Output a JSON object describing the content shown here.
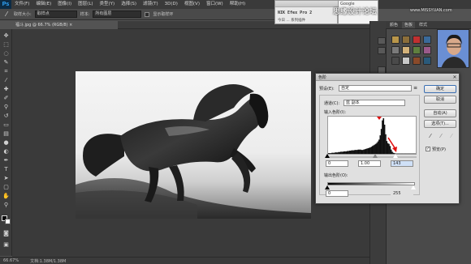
{
  "app": {
    "logo": "Ps"
  },
  "menu": [
    "文件(F)",
    "编辑(E)",
    "图像(I)",
    "图层(L)",
    "类型(Y)",
    "选择(S)",
    "滤镜(T)",
    "3D(D)",
    "视图(V)",
    "窗口(W)",
    "帮助(H)"
  ],
  "options": {
    "sample_size_label": "取样大小:",
    "sample_size_value": "取样点",
    "sample_label": "样本:",
    "sample_value": "所有图层",
    "show_ring_label": "显示取样环"
  },
  "document": {
    "tab_label": "福斗.jpg @ 66.7% (RGB/8) ×"
  },
  "status": {
    "zoom": "66.67%",
    "doc_size": "文档:1.38M/1.38M"
  },
  "overlay": {
    "nik_title": "NIK Efex Pro 2",
    "nik_sub": "今日 ... 系列插件",
    "google": "Google"
  },
  "watermark": {
    "main": "思缘设计论坛",
    "url": "www.MISSYUAN.com"
  },
  "panel_tabs": [
    "颜色",
    "色板",
    "样式"
  ],
  "swatch_colors": [
    "#b9964a",
    "#8c6e3a",
    "#c03030",
    "#3a6a9a",
    "#7a7a7a",
    "#d3b27a",
    "#5f7f3f",
    "#9a5a8a",
    "#4a4a4a",
    "#c9c9c9",
    "#8a4a2a",
    "#2a5a7a"
  ],
  "levels": {
    "title": "色阶",
    "preset_label": "预设(E):",
    "preset_value": "自定",
    "channel_label": "通道(C):",
    "channel_value": "蓝 副本",
    "input_label": "输入色阶(I):",
    "input_black": "0",
    "input_gamma": "1.00",
    "input_white": "143",
    "output_label": "输出色阶(O):",
    "output_black": "0",
    "output_white": "255",
    "buttons": {
      "ok": "确定",
      "cancel": "取消",
      "auto": "自动(A)",
      "options": "选项(T)..."
    },
    "preview_label": "预览(P)",
    "preview_checked": "✓",
    "histogram": [
      2,
      2,
      2,
      3,
      3,
      3,
      4,
      4,
      4,
      5,
      5,
      6,
      6,
      6,
      7,
      7,
      7,
      8,
      8,
      9,
      9,
      10,
      10,
      10,
      11,
      11,
      11,
      12,
      12,
      12,
      11,
      11,
      12,
      13,
      14,
      15,
      16,
      17,
      18,
      20,
      22,
      24,
      26,
      28,
      31,
      35,
      40,
      52,
      70,
      94,
      100,
      82,
      55,
      36,
      30,
      28,
      22,
      12,
      6,
      3,
      2,
      1,
      1,
      1,
      1,
      1,
      1,
      1,
      1,
      1,
      1,
      1,
      1,
      1,
      1,
      1,
      1,
      1,
      1,
      1
    ]
  }
}
